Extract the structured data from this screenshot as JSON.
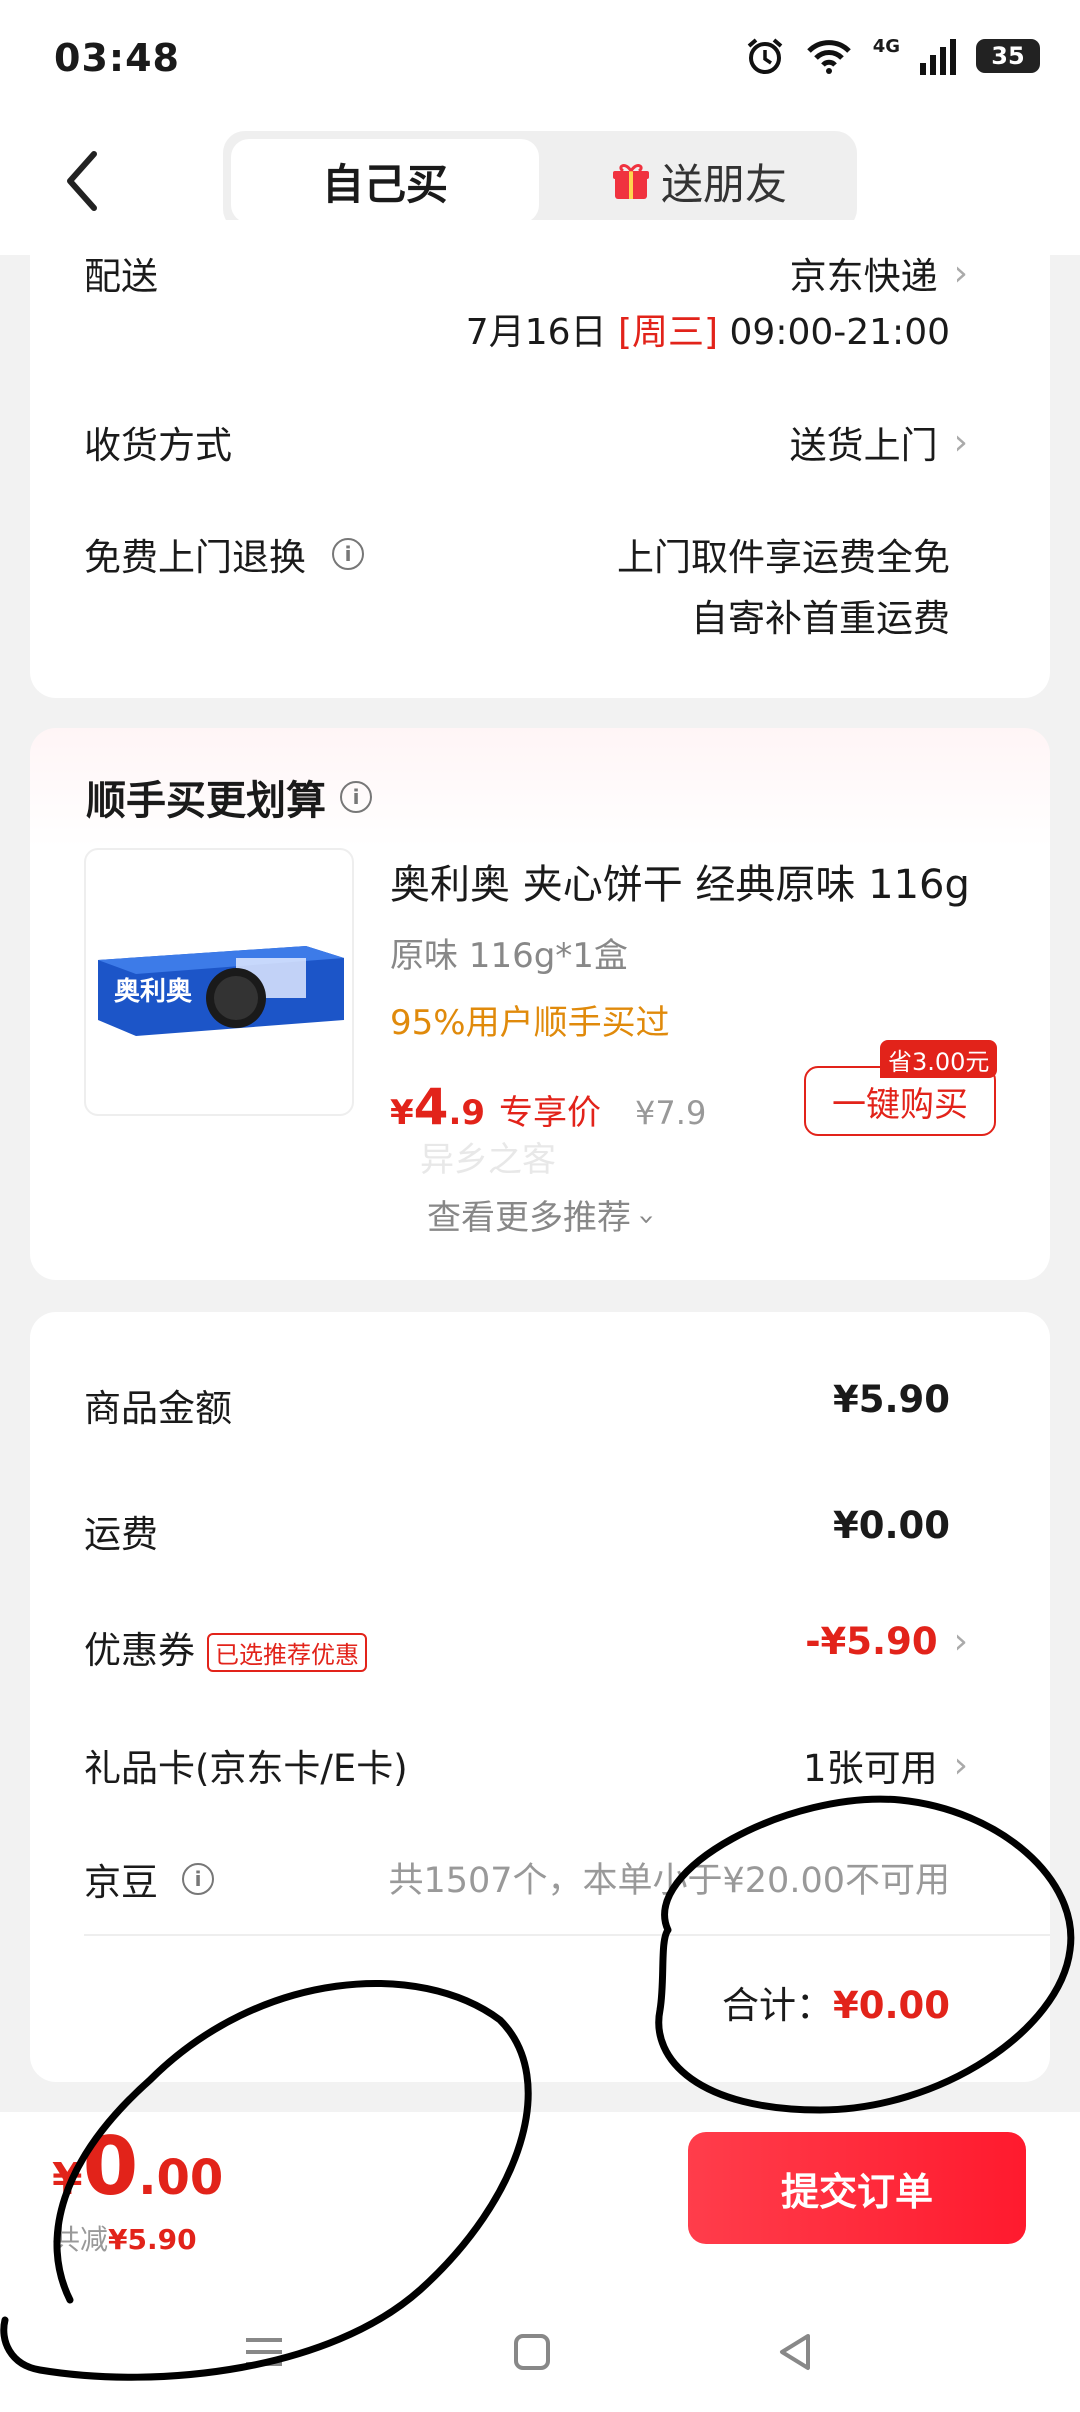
{
  "status": {
    "time": "03:48",
    "battery": "35",
    "network": "4G"
  },
  "header": {
    "tab_self": "自己买",
    "tab_gift": "送朋友"
  },
  "delivery": {
    "label": "配送",
    "carrier": "京东快递",
    "date": "7月16日",
    "weekday": "[周三]",
    "time_window": "09:00-21:00",
    "receive_label": "收货方式",
    "receive_value": "送货上门",
    "return_label": "免费上门退换",
    "return_line1": "上门取件享运费全免",
    "return_line2": "自寄补首重运费"
  },
  "recommend": {
    "title": "顺手买更划算",
    "product_name": "奥利奥 夹心饼干 经典原味 116g",
    "spec": "原味 116g*1盒",
    "buyers": "95%用户顺手买过",
    "price_symbol": "¥",
    "price_int": "4",
    "price_dec": ".9",
    "price_tag": "专享价",
    "orig_price": "¥7.9",
    "save_badge": "省3.00元",
    "buy_button": "一键购买",
    "watermark": "异乡之客",
    "more": "查看更多推荐"
  },
  "summary": {
    "goods_label": "商品金额",
    "goods_value": "¥5.90",
    "shipping_label": "运费",
    "shipping_value": "¥0.00",
    "coupon_label": "优惠券",
    "coupon_tag": "已选推荐优惠",
    "coupon_value": "-¥5.90",
    "giftcard_label": "礼品卡(京东卡/E卡)",
    "giftcard_value": "1张可用",
    "bean_label": "京豆",
    "bean_value": "共1507个，本单小于¥20.00不可用",
    "total_label": "合计：",
    "total_value": "¥0.00"
  },
  "bottom": {
    "symbol": "¥",
    "price_int": "0",
    "price_dec": ".00",
    "saved_label": "共减",
    "saved_value": "¥5.90",
    "submit": "提交订单"
  },
  "colors": {
    "accent": "#e2231a",
    "submit_start": "#ff3d4b",
    "submit_end": "#ff1a2e",
    "highlight": "#e08a0b"
  }
}
